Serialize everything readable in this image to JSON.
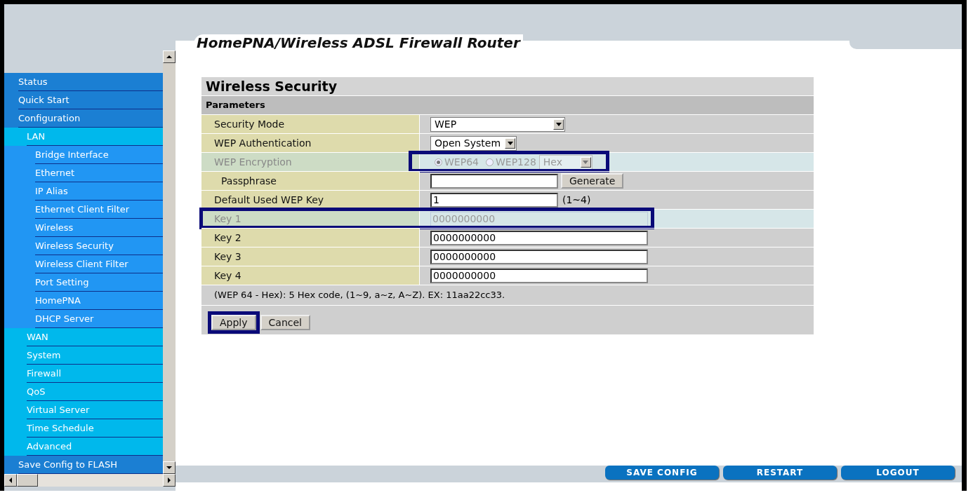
{
  "header": {
    "title": "HomePNA/Wireless ADSL Firewall Router"
  },
  "sidebar": {
    "items": [
      {
        "label": "Status"
      },
      {
        "label": "Quick Start"
      },
      {
        "label": "Configuration",
        "children": [
          {
            "label": "LAN",
            "children": [
              {
                "label": "Bridge Interface"
              },
              {
                "label": "Ethernet"
              },
              {
                "label": "IP Alias"
              },
              {
                "label": "Ethernet Client Filter"
              },
              {
                "label": "Wireless"
              },
              {
                "label": "Wireless Security"
              },
              {
                "label": "Wireless Client Filter"
              },
              {
                "label": "Port Setting"
              },
              {
                "label": "HomePNA"
              },
              {
                "label": "DHCP Server"
              }
            ]
          },
          {
            "label": "WAN"
          },
          {
            "label": "System"
          },
          {
            "label": "Firewall"
          },
          {
            "label": "QoS"
          },
          {
            "label": "Virtual Server"
          },
          {
            "label": "Time Schedule"
          },
          {
            "label": "Advanced"
          }
        ]
      },
      {
        "label": "Save Config to FLASH"
      }
    ]
  },
  "panel": {
    "title": "Wireless Security",
    "section": "Parameters",
    "rows": [
      {
        "kind": "select",
        "label": "Security Mode",
        "value": "WEP",
        "disabled": false,
        "highlighted": false
      },
      {
        "kind": "select",
        "label": "WEP Authentication",
        "value": "Open System",
        "disabled": false,
        "highlighted": false
      },
      {
        "kind": "radio",
        "label": "WEP Encryption",
        "options": [
          {
            "label": "WEP64",
            "selected": true
          },
          {
            "label": "WEP128",
            "selected": false
          }
        ],
        "format": "Hex",
        "disabled": true,
        "highlighted": true
      },
      {
        "kind": "passphrase",
        "label": "Passphrase",
        "value": "",
        "button": "Generate",
        "disabled": false,
        "highlighted": false
      },
      {
        "kind": "input",
        "label": "Default Used WEP Key",
        "value": "1",
        "hint": "(1~4)",
        "disabled": false,
        "highlighted": false
      },
      {
        "kind": "key",
        "label": "Key 1",
        "value": "0000000000",
        "disabled": true,
        "highlighted": true
      },
      {
        "kind": "key",
        "label": "Key 2",
        "value": "0000000000",
        "disabled": false,
        "highlighted": false
      },
      {
        "kind": "key",
        "label": "Key 3",
        "value": "0000000000",
        "disabled": false,
        "highlighted": false
      },
      {
        "kind": "key",
        "label": "Key 4",
        "value": "0000000000",
        "disabled": false,
        "highlighted": false
      }
    ],
    "note": "(WEP 64 - Hex): 5 Hex code, (1~9, a~z, A~Z). EX: 11aa22cc33.",
    "buttons": [
      {
        "label": "Apply",
        "highlighted": true
      },
      {
        "label": "Cancel",
        "highlighted": false
      }
    ]
  },
  "footer": {
    "buttons": [
      "SAVE CONFIG",
      "RESTART",
      "LOGOUT"
    ]
  }
}
